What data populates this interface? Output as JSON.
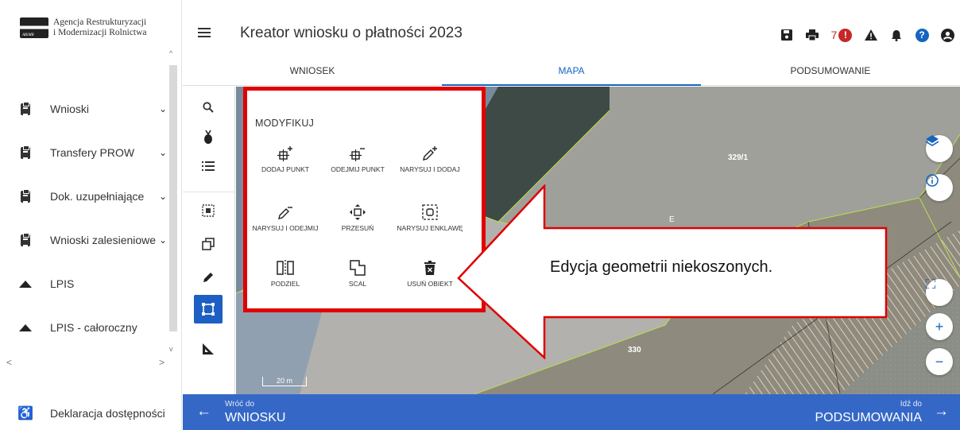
{
  "sidebar": {
    "logo_line1": "Agencja Restrukturyzacji",
    "logo_line2": "i Modernizacji Rolnictwa",
    "items": [
      {
        "label": "Wnioski",
        "icon": "clipboard-icon"
      },
      {
        "label": "Transfery PROW",
        "icon": "clipboard-icon"
      },
      {
        "label": "Dok. uzupełniające",
        "icon": "clipboard-icon"
      },
      {
        "label": "Wnioski zalesieniowe",
        "icon": "clipboard-icon"
      },
      {
        "label": "LPIS",
        "icon": "mountain-icon"
      },
      {
        "label": "LPIS - całoroczny",
        "icon": "mountain-icon"
      }
    ],
    "declaration": "Deklaracja dostępności"
  },
  "header": {
    "title": "Kreator wniosku o płatności 2023",
    "alert_count": "7"
  },
  "tabs": [
    {
      "label": "WNIOSEK",
      "active": false
    },
    {
      "label": "MAPA",
      "active": true
    },
    {
      "label": "PODSUMOWANIE",
      "active": false
    }
  ],
  "modify": {
    "title": "MODYFIKUJ",
    "buttons": [
      {
        "label": "DODAJ PUNKT"
      },
      {
        "label": "ODEJMIJ PUNKT"
      },
      {
        "label": "NARYSUJ I DODAJ"
      },
      {
        "label": "NARYSUJ I ODEJMIJ"
      },
      {
        "label": "PRZESUŃ"
      },
      {
        "label": "NARYSUJ ENKLAWĘ"
      },
      {
        "label": "PODZIEL"
      },
      {
        "label": "SCAL"
      },
      {
        "label": "USUŃ OBIEKT"
      }
    ]
  },
  "map": {
    "parcel_1": "329/1",
    "parcel_2": "330",
    "parcel_e": "E",
    "scale": "20 m"
  },
  "callout": "Edycja geometrii niekoszonych.",
  "footer": {
    "back_small": "Wróć do",
    "back_big": "WNIOSKU",
    "next_small": "Idź do",
    "next_big": "PODSUMOWANIA"
  },
  "colors": {
    "accent": "#3568c6",
    "highlight": "#e00000",
    "alert": "#c62828"
  }
}
